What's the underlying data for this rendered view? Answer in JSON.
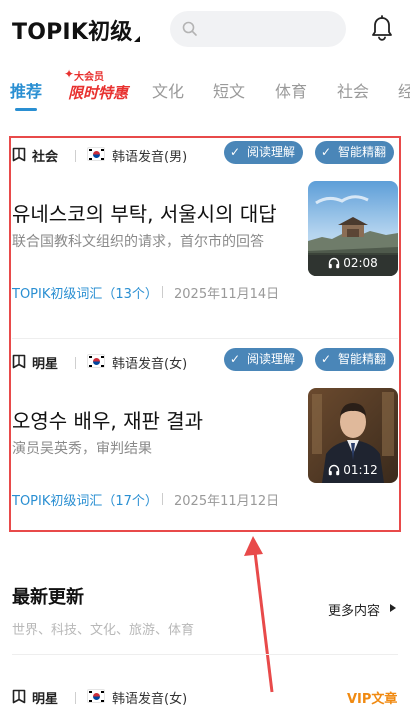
{
  "header": {
    "title": "TOPIK初级"
  },
  "tabs": [
    {
      "label": "推荐"
    },
    {
      "label": "文化"
    },
    {
      "label": "短文"
    },
    {
      "label": "体育"
    },
    {
      "label": "社会"
    },
    {
      "label": "经"
    }
  ],
  "promo": {
    "small": "大会员",
    "big": "限时特惠"
  },
  "articles": [
    {
      "category": "社会",
      "pronunciation": "韩语发音(男)",
      "tag_read": "阅读理解",
      "tag_translate": "智能精翻",
      "title_ko": "유네스코의 부탁, 서울시의 대답",
      "title_zh": "联合国教科文组织的请求，首尔市的回答",
      "vocab": "TOPIK初级词汇（13个）",
      "date": "2025年11月14日",
      "duration": "02:08"
    },
    {
      "category": "明星",
      "pronunciation": "韩语发音(女)",
      "tag_read": "阅读理解",
      "tag_translate": "智能精翻",
      "title_ko": "오영수 배우, 재판 결과",
      "title_zh": "演员吴英秀，审判结果",
      "vocab": "TOPIK初级词汇（17个）",
      "date": "2025年11月12日",
      "duration": "01:12"
    }
  ],
  "latest": {
    "title": "最新更新",
    "subtitle": "世界、科技、文化、旅游、体育",
    "more": "更多内容"
  },
  "bottom_item": {
    "category": "明星",
    "pronunciation": "韩语发音(女)",
    "vip": "VIP文章"
  },
  "colors": {
    "accent": "#2a8fd2",
    "tag_bg": "#4a86b8",
    "highlight": "#e84a4a",
    "vip": "#f08a12",
    "promo": "#e8312f"
  }
}
